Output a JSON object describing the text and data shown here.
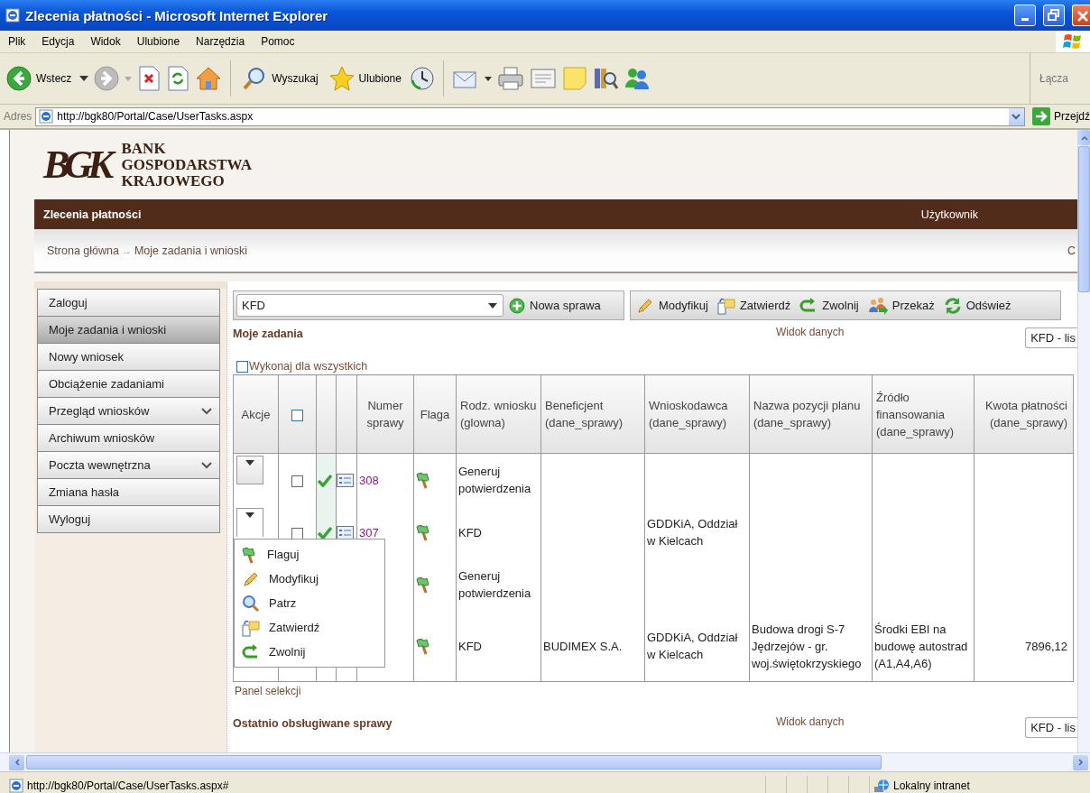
{
  "window": {
    "title": "Zlecenia płatności - Microsoft Internet Explorer"
  },
  "menu_bar": [
    "Plik",
    "Edycja",
    "Widok",
    "Ulubione",
    "Narzędzia",
    "Pomoc"
  ],
  "toolbar": {
    "back": "Wstecz",
    "search": "Wyszukaj",
    "favorites": "Ulubione",
    "links": "Łącza"
  },
  "address_bar": {
    "label": "Adres",
    "url": "http://bgk80/Portal/Case/UserTasks.aspx",
    "go": "Przejdź"
  },
  "page": {
    "logo": {
      "monogram": "BGK",
      "name": [
        "BANK",
        "GOSPODARSTWA",
        "KRAJOWEGO"
      ]
    },
    "header_bar": {
      "title": "Zlecenia płatności",
      "user": "Użytkownik"
    },
    "breadcrumb": {
      "items": [
        "Strona główna",
        "Moje zadania i wnioski"
      ],
      "separator": "→",
      "right_text": "C"
    },
    "sidebar": {
      "items": [
        {
          "label": "Zaloguj",
          "selected": false,
          "expandable": false
        },
        {
          "label": "Moje zadania i wnioski",
          "selected": true,
          "expandable": false
        },
        {
          "label": "Nowy wniosek",
          "selected": false,
          "expandable": false
        },
        {
          "label": "Obciążenie zadaniami",
          "selected": false,
          "expandable": false
        },
        {
          "label": "Przegląd wniosków",
          "selected": false,
          "expandable": true
        },
        {
          "label": "Archiwum wniosków",
          "selected": false,
          "expandable": false
        },
        {
          "label": "Poczta wewnętrzna",
          "selected": false,
          "expandable": true
        },
        {
          "label": "Zmiana hasła",
          "selected": false,
          "expandable": false
        },
        {
          "label": "Wyloguj",
          "selected": false,
          "expandable": false
        }
      ]
    },
    "case_type": "KFD",
    "new_case": "Nowa sprawa",
    "actions": [
      "Modyfikuj",
      "Zatwierdź",
      "Zwolnij",
      "Przekaż",
      "Odśwież"
    ],
    "my_tasks": {
      "title": "Moje zadania",
      "view_label": "Widok danych",
      "view_select": "KFD - lis",
      "apply_all": {
        "label": "Wykonaj dla wszystkich",
        "checked": false
      },
      "columns": [
        {
          "kind": "text",
          "label": "Akcje"
        },
        {
          "kind": "checkbox",
          "checked": false
        },
        {
          "kind": "blank"
        },
        {
          "kind": "blank"
        },
        {
          "kind": "text",
          "label": "Numer sprawy"
        },
        {
          "kind": "text",
          "label": "Flaga"
        },
        {
          "kind": "text",
          "label": "Rodz. wniosku (glowna)"
        },
        {
          "kind": "text",
          "label": "Beneficjent (dane_sprawy)"
        },
        {
          "kind": "text",
          "label": "Wnioskodawca (dane_sprawy)"
        },
        {
          "kind": "text",
          "label": "Nazwa pozycji planu (dane_sprawy)"
        },
        {
          "kind": "text",
          "label": "Źródło finansowania (dane_sprawy)"
        },
        {
          "kind": "text",
          "label": "Kwota płatności (dane_sprawy)"
        }
      ],
      "rows": [
        {
          "menu_open": false,
          "checked": false,
          "number": "308",
          "type": "Generuj potwierdzenia"
        },
        {
          "menu_open": true,
          "checked": false,
          "number": "307",
          "type": "KFD",
          "applicant": "GDDKiA, Oddział w Kielcach"
        },
        {
          "type": "Generuj potwierdzenia"
        },
        {
          "type": "KFD",
          "beneficiary": "BUDIMEX S.A.",
          "applicant": "GDDKiA, Oddział w Kielcach",
          "plan_item": "Budowa drogi S-7 Jędrzejów - gr. woj.świętokrzyskiego",
          "source": "Środki EBI na budowę autostrad (A1,A4,A6)",
          "amount": "7896,12"
        }
      ],
      "context_menu": [
        "Flaguj",
        "Modyfikuj",
        "Patrz",
        "Zatwierdź",
        "Zwolnij"
      ],
      "footer": "Panel selekcji"
    },
    "recent": {
      "title": "Ostatnio obsługiwane sprawy",
      "view_label": "Widok danych",
      "view_select": "KFD - lis"
    }
  },
  "status_bar": {
    "url": "http://bgk80/Portal/Case/UserTasks.aspx#",
    "zone": "Lokalny intranet"
  }
}
